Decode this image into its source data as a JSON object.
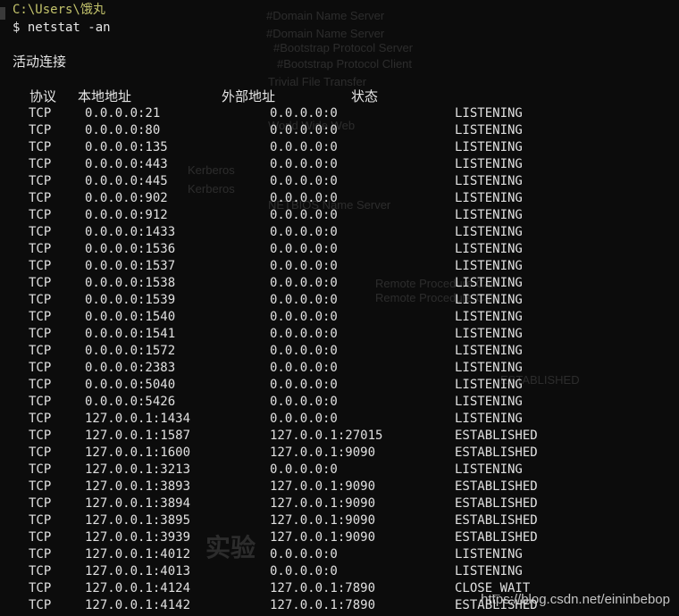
{
  "terminal": {
    "path": "C:\\Users\\饿丸",
    "command": "$ netstat -an",
    "section_title": "活动连接",
    "headers": {
      "proto": "协议",
      "local": "本地地址",
      "foreign": "外部地址",
      "state": "状态"
    },
    "rows": [
      {
        "proto": "TCP",
        "local": "0.0.0.0:21",
        "foreign": "0.0.0.0:0",
        "state": "LISTENING"
      },
      {
        "proto": "TCP",
        "local": "0.0.0.0:80",
        "foreign": "0.0.0.0:0",
        "state": "LISTENING"
      },
      {
        "proto": "TCP",
        "local": "0.0.0.0:135",
        "foreign": "0.0.0.0:0",
        "state": "LISTENING"
      },
      {
        "proto": "TCP",
        "local": "0.0.0.0:443",
        "foreign": "0.0.0.0:0",
        "state": "LISTENING"
      },
      {
        "proto": "TCP",
        "local": "0.0.0.0:445",
        "foreign": "0.0.0.0:0",
        "state": "LISTENING"
      },
      {
        "proto": "TCP",
        "local": "0.0.0.0:902",
        "foreign": "0.0.0.0:0",
        "state": "LISTENING"
      },
      {
        "proto": "TCP",
        "local": "0.0.0.0:912",
        "foreign": "0.0.0.0:0",
        "state": "LISTENING"
      },
      {
        "proto": "TCP",
        "local": "0.0.0.0:1433",
        "foreign": "0.0.0.0:0",
        "state": "LISTENING"
      },
      {
        "proto": "TCP",
        "local": "0.0.0.0:1536",
        "foreign": "0.0.0.0:0",
        "state": "LISTENING"
      },
      {
        "proto": "TCP",
        "local": "0.0.0.0:1537",
        "foreign": "0.0.0.0:0",
        "state": "LISTENING"
      },
      {
        "proto": "TCP",
        "local": "0.0.0.0:1538",
        "foreign": "0.0.0.0:0",
        "state": "LISTENING"
      },
      {
        "proto": "TCP",
        "local": "0.0.0.0:1539",
        "foreign": "0.0.0.0:0",
        "state": "LISTENING"
      },
      {
        "proto": "TCP",
        "local": "0.0.0.0:1540",
        "foreign": "0.0.0.0:0",
        "state": "LISTENING"
      },
      {
        "proto": "TCP",
        "local": "0.0.0.0:1541",
        "foreign": "0.0.0.0:0",
        "state": "LISTENING"
      },
      {
        "proto": "TCP",
        "local": "0.0.0.0:1572",
        "foreign": "0.0.0.0:0",
        "state": "LISTENING"
      },
      {
        "proto": "TCP",
        "local": "0.0.0.0:2383",
        "foreign": "0.0.0.0:0",
        "state": "LISTENING"
      },
      {
        "proto": "TCP",
        "local": "0.0.0.0:5040",
        "foreign": "0.0.0.0:0",
        "state": "LISTENING"
      },
      {
        "proto": "TCP",
        "local": "0.0.0.0:5426",
        "foreign": "0.0.0.0:0",
        "state": "LISTENING"
      },
      {
        "proto": "TCP",
        "local": "127.0.0.1:1434",
        "foreign": "0.0.0.0:0",
        "state": "LISTENING"
      },
      {
        "proto": "TCP",
        "local": "127.0.0.1:1587",
        "foreign": "127.0.0.1:27015",
        "state": "ESTABLISHED"
      },
      {
        "proto": "TCP",
        "local": "127.0.0.1:1600",
        "foreign": "127.0.0.1:9090",
        "state": "ESTABLISHED"
      },
      {
        "proto": "TCP",
        "local": "127.0.0.1:3213",
        "foreign": "0.0.0.0:0",
        "state": "LISTENING"
      },
      {
        "proto": "TCP",
        "local": "127.0.0.1:3893",
        "foreign": "127.0.0.1:9090",
        "state": "ESTABLISHED"
      },
      {
        "proto": "TCP",
        "local": "127.0.0.1:3894",
        "foreign": "127.0.0.1:9090",
        "state": "ESTABLISHED"
      },
      {
        "proto": "TCP",
        "local": "127.0.0.1:3895",
        "foreign": "127.0.0.1:9090",
        "state": "ESTABLISHED"
      },
      {
        "proto": "TCP",
        "local": "127.0.0.1:3939",
        "foreign": "127.0.0.1:9090",
        "state": "ESTABLISHED"
      },
      {
        "proto": "TCP",
        "local": "127.0.0.1:4012",
        "foreign": "0.0.0.0:0",
        "state": "LISTENING"
      },
      {
        "proto": "TCP",
        "local": "127.0.0.1:4013",
        "foreign": "0.0.0.0:0",
        "state": "LISTENING"
      },
      {
        "proto": "TCP",
        "local": "127.0.0.1:4124",
        "foreign": "127.0.0.1:7890",
        "state": "CLOSE_WAIT"
      },
      {
        "proto": "TCP",
        "local": "127.0.0.1:4142",
        "foreign": "127.0.0.1:7890",
        "state": "ESTABLISHED"
      }
    ]
  },
  "ghost_text": [
    "#Domain Name Server",
    "#Domain Name Server",
    "#Bootstrap Protocol Server",
    "#Bootstrap Protocol Client",
    "Trivial File Transfer",
    "World Wide Web",
    "Kerberos",
    "Kerberos",
    "NETBIOS Name Server",
    "Remote Procedure Call",
    "Remote Procedure Call",
    "ESTABLISHED",
    "实验"
  ],
  "watermark": "https://blog.csdn.net/eininbebop",
  "colors": {
    "background": "#0c0c0c",
    "path": "#c3c36b",
    "text": "#e0e0e0"
  }
}
